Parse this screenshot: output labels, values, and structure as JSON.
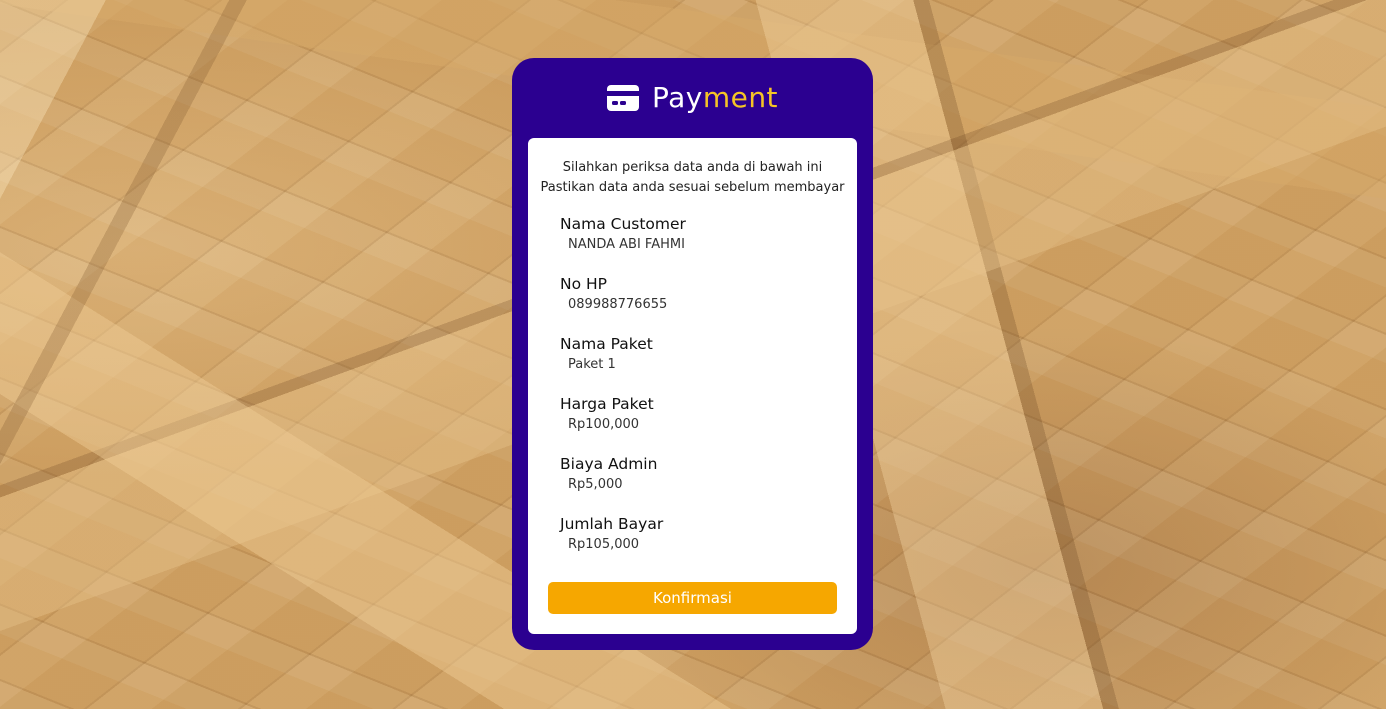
{
  "header": {
    "icon": "credit-card-icon",
    "brand_part1": "Pay",
    "brand_part2": "ment",
    "colors": {
      "card_bg": "#2b0090",
      "accent_yellow": "#f5c426",
      "button": "#f6a700"
    }
  },
  "intro": {
    "line1": "Silahkan periksa data anda di bawah ini",
    "line2": "Pastikan data anda sesuai sebelum membayar"
  },
  "fields": [
    {
      "label": "Nama Customer",
      "value": "NANDA ABI FAHMI"
    },
    {
      "label": "No HP",
      "value": "089988776655"
    },
    {
      "label": "Nama Paket",
      "value": "Paket 1"
    },
    {
      "label": "Harga Paket",
      "value": "Rp100,000"
    },
    {
      "label": "Biaya Admin",
      "value": "Rp5,000"
    },
    {
      "label": "Jumlah Bayar",
      "value": "Rp105,000"
    }
  ],
  "confirm_button": {
    "label": "Konfirmasi"
  }
}
